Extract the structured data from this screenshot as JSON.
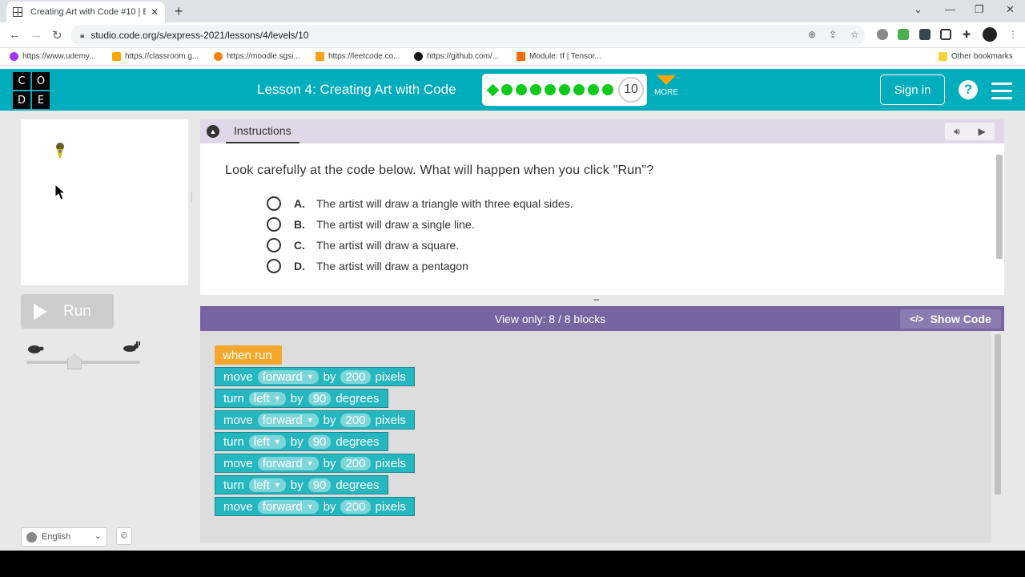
{
  "browser": {
    "tab_title": "Creating Art with Code #10 | Exp",
    "url": "studio.code.org/s/express-2021/lessons/4/levels/10",
    "bookmarks": [
      "https://www.udemy...",
      "https://classroom.g...",
      "https://moodle.sgsi...",
      "https://leetcode.co...",
      "https://github.com/...",
      "Module: tf | Tensor..."
    ],
    "other_bookmarks": "Other bookmarks"
  },
  "header": {
    "logo_letters": [
      "C",
      "O",
      "D",
      "E"
    ],
    "lesson_title": "Lesson 4: Creating Art with Code",
    "level_number": "10",
    "more_label": "MORE",
    "signin_label": "Sign in",
    "help_label": "?"
  },
  "progress": {
    "completed_levels": 9,
    "current_level": 10
  },
  "left": {
    "run_label": "Run",
    "speed_slider_fraction": 0.42,
    "language": "English",
    "copyright": "©"
  },
  "instructions": {
    "header_label": "Instructions",
    "question": "Look carefully at the code below. What will happen when you click \"Run\"?",
    "options": [
      {
        "letter": "A.",
        "text": "The artist will draw a triangle with three equal sides."
      },
      {
        "letter": "B.",
        "text": "The artist will draw a single line."
      },
      {
        "letter": "C.",
        "text": "The artist will draw a square."
      },
      {
        "letter": "D.",
        "text": "The artist will draw a pentagon"
      }
    ]
  },
  "workspace": {
    "title": "View only: 8 / 8 blocks",
    "show_code_label": "Show Code",
    "when_run": "when run",
    "blocks": [
      {
        "verb": "move",
        "dir": "forward",
        "by": "by",
        "value": "200",
        "unit": "pixels"
      },
      {
        "verb": "turn",
        "dir": "left",
        "by": "by",
        "value": "90",
        "unit": "degrees"
      },
      {
        "verb": "move",
        "dir": "forward",
        "by": "by",
        "value": "200",
        "unit": "pixels"
      },
      {
        "verb": "turn",
        "dir": "left",
        "by": "by",
        "value": "90",
        "unit": "degrees"
      },
      {
        "verb": "move",
        "dir": "forward",
        "by": "by",
        "value": "200",
        "unit": "pixels"
      },
      {
        "verb": "turn",
        "dir": "left",
        "by": "by",
        "value": "90",
        "unit": "degrees"
      },
      {
        "verb": "move",
        "dir": "forward",
        "by": "by",
        "value": "200",
        "unit": "pixels"
      }
    ]
  },
  "colors": {
    "brand_teal": "#00adbc",
    "progress_green": "#0eca1b",
    "workspace_purple": "#7665a0",
    "block_teal": "#25b7c0",
    "block_orange": "#f4a72a"
  }
}
